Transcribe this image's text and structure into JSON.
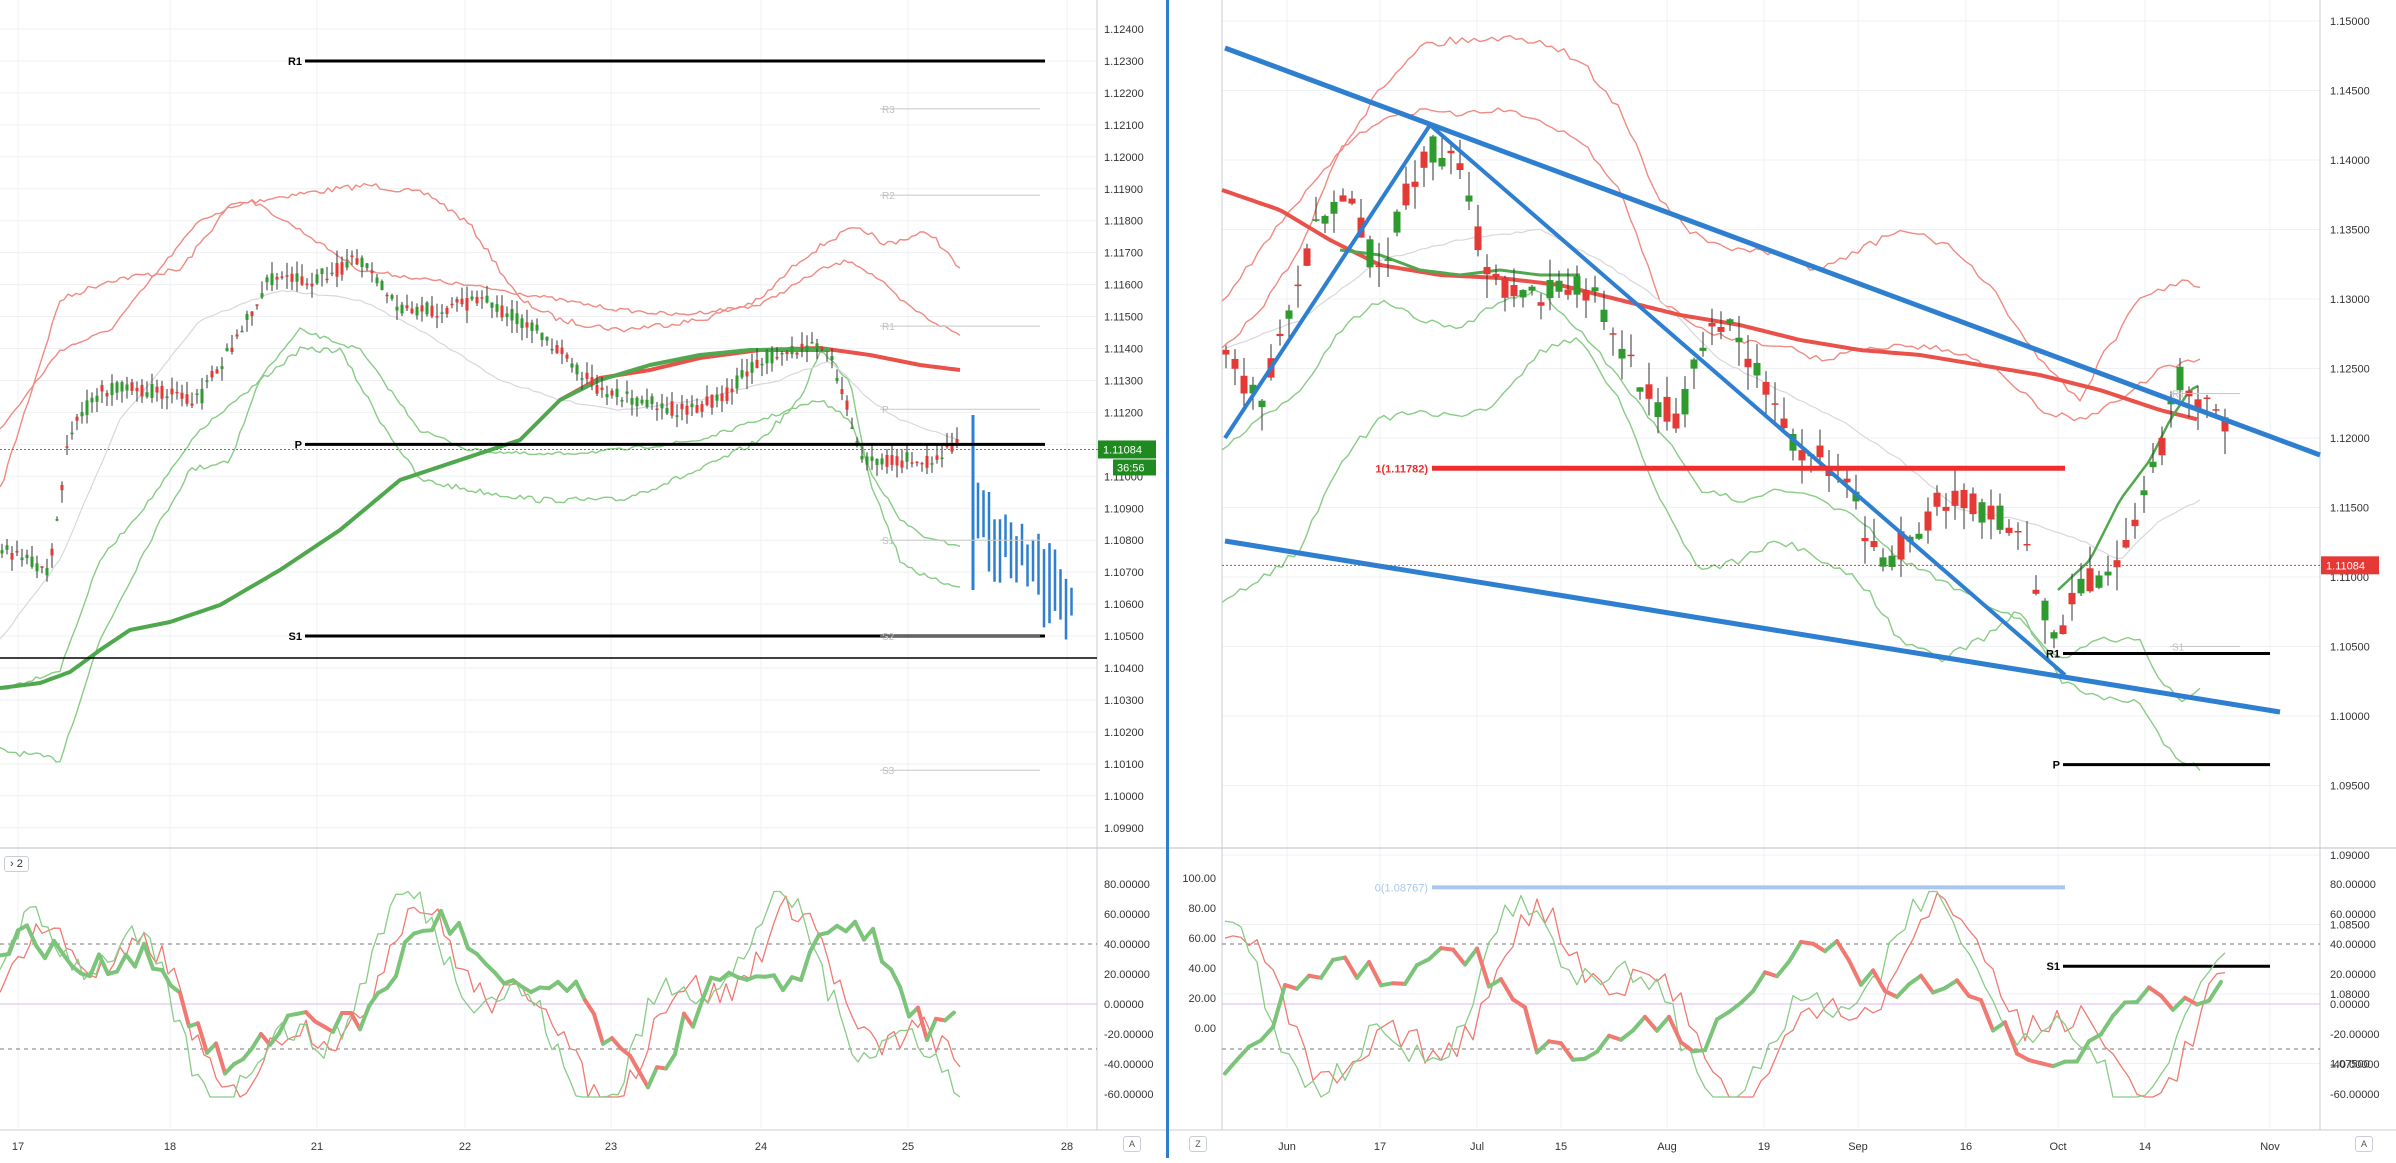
{
  "colors": {
    "green": "#2e9b2e",
    "red": "#e53935",
    "blue": "#2f7fd0",
    "bb_red": "#ef7a72",
    "bb_green": "#7cc57a",
    "level": "#000000",
    "price_badge_green": "#1f8a1f",
    "price_badge_red": "#e53935"
  },
  "left_pane": {
    "indicator_tag": "2",
    "price_badge": "1.11084",
    "countdown_badge": "36:56",
    "price_axis_ticks": [
      "1.12400",
      "1.12300",
      "1.12200",
      "1.12100",
      "1.12000",
      "1.11900",
      "1.11800",
      "1.11700",
      "1.11600",
      "1.11500",
      "1.11400",
      "1.11300",
      "1.11200",
      "1.11100",
      "1.11000",
      "1.10900",
      "1.10800",
      "1.10700",
      "1.10600",
      "1.10500",
      "1.10400",
      "1.10300",
      "1.10200",
      "1.10100",
      "1.10000",
      "1.09900"
    ],
    "osc_axis_ticks": [
      "80.00000",
      "60.00000",
      "40.00000",
      "20.00000",
      "0.00000",
      "-20.00000",
      "-40.00000",
      "-60.00000"
    ],
    "time_axis": [
      "17",
      "18",
      "21",
      "22",
      "23",
      "24",
      "25",
      "28"
    ],
    "axis_badge": "A",
    "levels": [
      {
        "label": "R1",
        "price": 1.123
      },
      {
        "label": "P",
        "price": 1.111
      },
      {
        "label": "S1",
        "price": 1.105
      }
    ],
    "faint_levels": [
      {
        "label": "R3",
        "price": 1.1215
      },
      {
        "label": "R2",
        "price": 1.1188
      },
      {
        "label": "R1",
        "price": 1.1147
      },
      {
        "label": "P",
        "price": 1.1121
      },
      {
        "label": "S1",
        "price": 1.108
      },
      {
        "label": "S2",
        "price": 1.105
      },
      {
        "label": "S3",
        "price": 1.1008
      }
    ]
  },
  "right_pane": {
    "price_badge": "1.11084",
    "price_axis_ticks": [
      "1.15000",
      "1.14500",
      "1.14000",
      "1.13500",
      "1.13000",
      "1.12500",
      "1.12000",
      "1.11500",
      "1.11000",
      "1.10500",
      "1.10000",
      "1.09500",
      "1.09000",
      "1.08500",
      "1.08000",
      "1.07500"
    ],
    "osc_left_ticks": [
      "100.00",
      "80.00",
      "60.00",
      "40.00",
      "20.00",
      "0.00"
    ],
    "osc_right_ticks": [
      "80.00000",
      "60.00000",
      "40.00000",
      "20.00000",
      "0.00000",
      "-20.00000",
      "-40.00000",
      "-60.00000"
    ],
    "time_axis": [
      "Jun",
      "17",
      "Jul",
      "15",
      "Aug",
      "19",
      "Sep",
      "16",
      "Oct",
      "14",
      "Nov"
    ],
    "left_badge": "Z",
    "axis_badge": "A",
    "fib_levels": [
      {
        "label": "1(1.11782)",
        "price": 1.11782
      },
      {
        "label": "0(1.08767)",
        "price": 1.08767
      }
    ],
    "levels": [
      {
        "label": "R1",
        "price": 1.1045
      },
      {
        "label": "P",
        "price": 1.0965
      },
      {
        "label": "S1",
        "price": 1.082
      }
    ],
    "faint_levels": [
      {
        "label": "R1",
        "price": 1.1232
      },
      {
        "label": "S1",
        "price": 1.105
      }
    ]
  }
}
